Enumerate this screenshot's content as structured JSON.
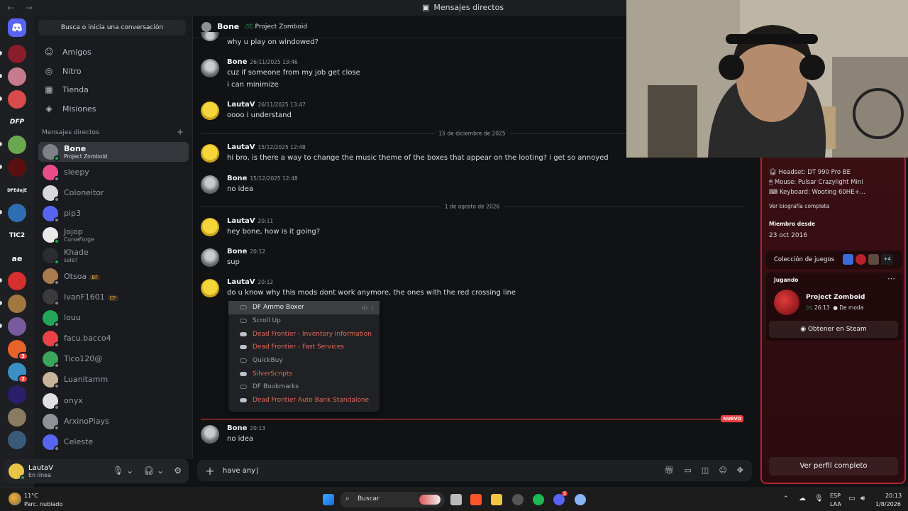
{
  "window": {
    "title": "Mensajes directos"
  },
  "rail": {
    "servers": [
      {
        "label": "DFP"
      },
      {
        "label": "DFEdeJE"
      },
      {
        "label": "TIC2"
      },
      {
        "label": "ae"
      }
    ],
    "badges": [
      "3",
      "2"
    ]
  },
  "sidebar": {
    "search": "Busca o inicia una conversación",
    "nav": [
      {
        "label": "Amigos",
        "icon": "friends-icon"
      },
      {
        "label": "Nitro",
        "icon": "nitro-icon"
      },
      {
        "label": "Tienda",
        "icon": "shop-icon"
      },
      {
        "label": "Misiones",
        "icon": "quests-icon"
      }
    ],
    "dm_header": "Mensajes directos",
    "dms": [
      {
        "name": "Bone",
        "sub": "Project Zomboid",
        "color": "#7d8287",
        "status": "#23a55a",
        "active": true
      },
      {
        "name": "sleepy",
        "sub": "",
        "color": "#e84d8a",
        "status": "#80848e"
      },
      {
        "name": "Coloneitor",
        "sub": "",
        "color": "#d8d8d8",
        "status": "#80848e"
      },
      {
        "name": "pip3",
        "sub": "",
        "color": "#5865f2",
        "status": "#80848e"
      },
      {
        "name": "Jojop",
        "sub": "CurseForge",
        "color": "#e9e9e9",
        "status": "#23a55a"
      },
      {
        "name": "Khade",
        "sub": "sale?",
        "color": "#2b2d31",
        "status": "#23a55a"
      },
      {
        "name": "Otsoa",
        "sub": "",
        "tag": "BF",
        "color": "#a97c50",
        "status": "#80848e"
      },
      {
        "name": "IvanF1601",
        "sub": "",
        "tag": "CF",
        "color": "#3a3a3a",
        "status": "#80848e"
      },
      {
        "name": "louu",
        "sub": "",
        "color": "#23a55a",
        "status": "#80848e"
      },
      {
        "name": "facu.bacco4",
        "sub": "",
        "color": "#ed4245",
        "status": "#80848e"
      },
      {
        "name": "Tico120@",
        "sub": "",
        "color": "#3ba55c",
        "status": "#80848e"
      },
      {
        "name": "Luanitamm",
        "sub": "",
        "color": "#c9b39a",
        "status": "#80848e"
      },
      {
        "name": "onyx",
        "sub": "",
        "color": "#e0e0e0",
        "status": "#80848e"
      },
      {
        "name": "ArxinoPlays",
        "sub": "",
        "color": "#8e9297",
        "status": "#80848e"
      },
      {
        "name": "Celeste",
        "sub": "",
        "color": "#5865f2",
        "status": "#80848e"
      }
    ]
  },
  "user": {
    "name": "LautaV",
    "status": "En línea"
  },
  "chat": {
    "header_name": "Bone",
    "header_game": "Project Zomboid",
    "top_line": "why u play on windowed?",
    "messages": [
      {
        "who": "Bone",
        "ts": "26/11/2025 13:46",
        "lines": [
          "cuz if someone from my job get close",
          "i can minimize"
        ]
      },
      {
        "who": "LautaV",
        "ts": "26/11/2025 13:47",
        "lines": [
          "oooo i understand"
        ]
      },
      {
        "who": "LautaV",
        "ts": "15/12/2025 12:48",
        "lines": [
          "hi bro, is there a way to change the music theme of the boxes that appear on the looting? i get so annoyed"
        ]
      },
      {
        "who": "Bone",
        "ts": "15/12/2025 12:48",
        "lines": [
          "no idea"
        ]
      },
      {
        "who": "LautaV",
        "ts": "20:11",
        "lines": [
          "hey bone, how is it going?"
        ]
      },
      {
        "who": "Bone",
        "ts": "20:12",
        "lines": [
          "sup"
        ]
      },
      {
        "who": "LautaV",
        "ts": "20:12",
        "lines": [
          "do u know why this mods dont work anymore, the ones with the red crossing line"
        ]
      },
      {
        "who": "Bone",
        "ts": "20:13",
        "lines": [
          "no idea"
        ]
      }
    ],
    "dividers": [
      "15 de diciembre de 2025",
      "1 de agosto de 2026"
    ],
    "new_label": "NUEVO",
    "composer_value": "have any"
  },
  "extensions": [
    {
      "name": "DF Ammo Boxer",
      "on": false,
      "red": false
    },
    {
      "name": "Scroll Up",
      "on": false,
      "red": false
    },
    {
      "name": "Dead Frontier - Inventory Information",
      "on": true,
      "red": true
    },
    {
      "name": "Dead Frontier - Fast Services",
      "on": true,
      "red": true
    },
    {
      "name": "QuickBuy",
      "on": false,
      "red": false
    },
    {
      "name": "SilverScripts",
      "on": true,
      "red": true
    },
    {
      "name": "DF Bookmarks",
      "on": false,
      "red": false
    },
    {
      "name": "Dead Frontier Auto Bank Standalone",
      "on": true,
      "red": true
    }
  ],
  "profile": {
    "bio": [
      "Headset: DT 990 Pro BE",
      "Mouse: Pulsar Crazylight Mini",
      "Keyboard: Wooting 60HE+..."
    ],
    "bio_link": "Ver biografía completa",
    "member_label": "Miembro desde",
    "member_since": "23 oct 2016",
    "collection_label": "Colección de juegos",
    "collection_more": "+4",
    "playing_label": "Jugando",
    "game": "Project Zomboid",
    "game_time": "26:13",
    "game_status": "De moda",
    "steam_btn": "Obtener en Steam",
    "full_btn": "Ver perfil completo"
  },
  "taskbar": {
    "temp": "11°C",
    "weather": "Parc. nublado",
    "search": "Buscar",
    "lang1": "ESP",
    "lang2": "LAA",
    "time": "20:13",
    "date": "1/8/2026",
    "discord_badge": "5"
  }
}
